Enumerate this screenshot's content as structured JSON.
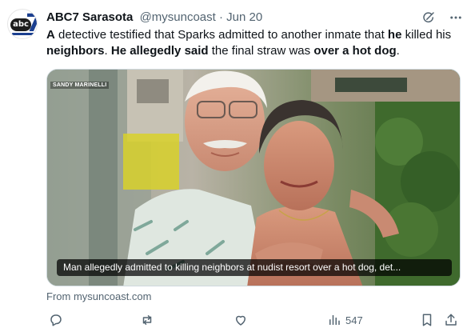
{
  "post": {
    "author_name": "ABC7 Sarasota",
    "author_handle": "@mysuncoast",
    "separator": "·",
    "date": "Jun 20",
    "avatar_text": "abc",
    "avatar_digit": "7",
    "text_segments": [
      {
        "text": "A",
        "bold": true
      },
      {
        "text": " detective testified that Sparks admitted to another inmate that ",
        "bold": false
      },
      {
        "text": "he",
        "bold": true
      },
      {
        "text": " killed his ",
        "bold": false
      },
      {
        "text": "neighbors",
        "bold": true
      },
      {
        "text": ". ",
        "bold": false
      },
      {
        "text": "He allegedly said",
        "bold": true
      },
      {
        "text": " the final straw was ",
        "bold": false
      },
      {
        "text": "over a hot dog",
        "bold": true
      },
      {
        "text": ".",
        "bold": false
      }
    ]
  },
  "media": {
    "credit": "SANDY MARINELLI",
    "caption": "Man allegedly admitted to killing neighbors at nudist resort over a hot dog, det...",
    "source": "From mysuncoast.com"
  },
  "actions": {
    "views": "547",
    "icons": [
      "reply-icon",
      "repost-icon",
      "like-icon",
      "views-icon",
      "bookmark-icon",
      "share-icon",
      "grok-icon",
      "more-icon"
    ]
  },
  "colors": {
    "text": "#0f1419",
    "muted": "#536471",
    "border": "#cfd9de",
    "brand_blue": "#1b3f8f"
  }
}
